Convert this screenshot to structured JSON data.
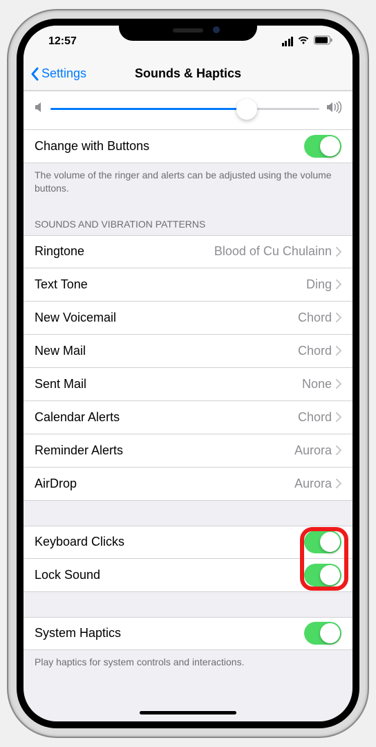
{
  "status": {
    "time": "12:57"
  },
  "nav": {
    "back_label": "Settings",
    "title": "Sounds & Haptics"
  },
  "volume": {
    "slider_percent": 73
  },
  "rows": {
    "change_btn": "Change with Buttons",
    "volume_footer": "The volume of the ringer and alerts can be adjusted using the volume buttons.",
    "section_header": "SOUNDS AND VIBRATION PATTERNS",
    "ringtone_label": "Ringtone",
    "ringtone_value": "Blood of Cu Chulainn",
    "text_tone_label": "Text Tone",
    "text_tone_value": "Ding",
    "voicemail_label": "New Voicemail",
    "voicemail_value": "Chord",
    "newmail_label": "New Mail",
    "newmail_value": "Chord",
    "sentmail_label": "Sent Mail",
    "sentmail_value": "None",
    "calendar_label": "Calendar Alerts",
    "calendar_value": "Chord",
    "reminder_label": "Reminder Alerts",
    "reminder_value": "Aurora",
    "airdrop_label": "AirDrop",
    "airdrop_value": "Aurora",
    "keyboard_label": "Keyboard Clicks",
    "lock_label": "Lock Sound",
    "haptics_label": "System Haptics",
    "haptics_footer": "Play haptics for system controls and interactions."
  }
}
